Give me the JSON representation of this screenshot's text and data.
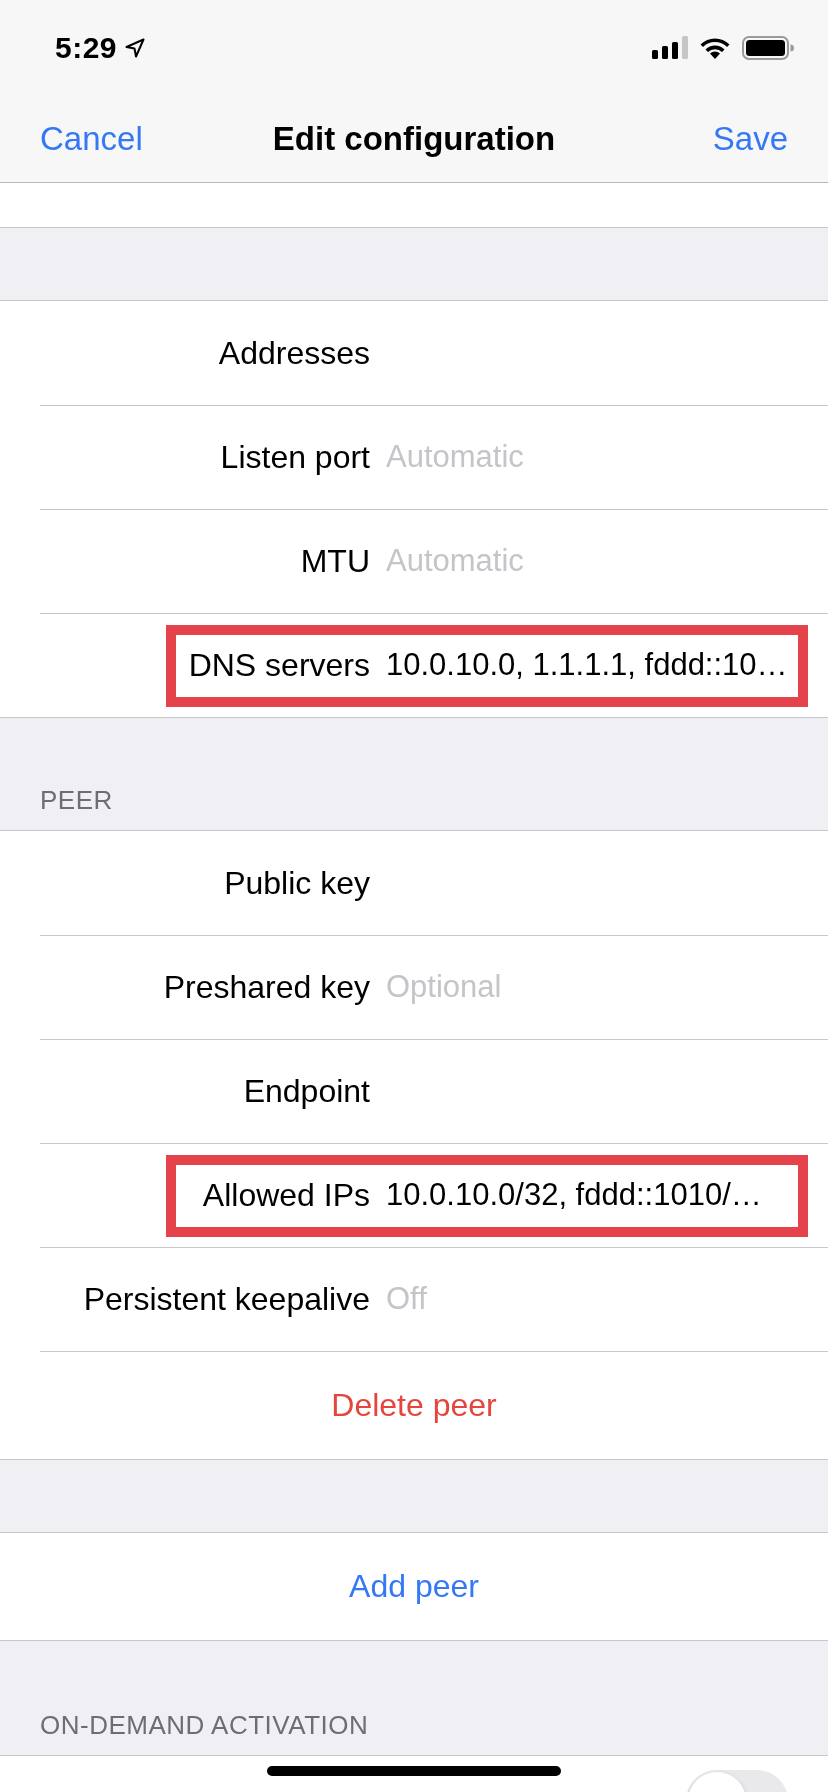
{
  "status_bar": {
    "time": "5:29"
  },
  "nav_bar": {
    "cancel": "Cancel",
    "title": "Edit configuration",
    "save": "Save"
  },
  "interface": {
    "fields": [
      {
        "label": "Addresses",
        "highlighted": false
      },
      {
        "label": "Listen port",
        "placeholder": "Automatic",
        "highlighted": false
      },
      {
        "label": "MTU",
        "placeholder": "Automatic",
        "highlighted": false
      },
      {
        "label": "DNS servers",
        "value": "10.0.10.0, 1.1.1.1, fddd::10…",
        "highlighted": true
      }
    ]
  },
  "peer": {
    "header": "PEER",
    "fields": [
      {
        "label": "Public key",
        "highlighted": false
      },
      {
        "label": "Preshared key",
        "placeholder": "Optional",
        "highlighted": false
      },
      {
        "label": "Endpoint",
        "highlighted": false
      },
      {
        "label": "Allowed IPs",
        "value": "10.0.10.0/32, fddd::1010/…",
        "highlighted": true
      },
      {
        "label": "Persistent keepalive",
        "placeholder": "Off",
        "highlighted": false
      }
    ],
    "delete_button": "Delete peer"
  },
  "add_peer_button": "Add peer",
  "on_demand": {
    "header": "ON-DEMAND ACTIVATION",
    "switch": {
      "on": false
    }
  }
}
